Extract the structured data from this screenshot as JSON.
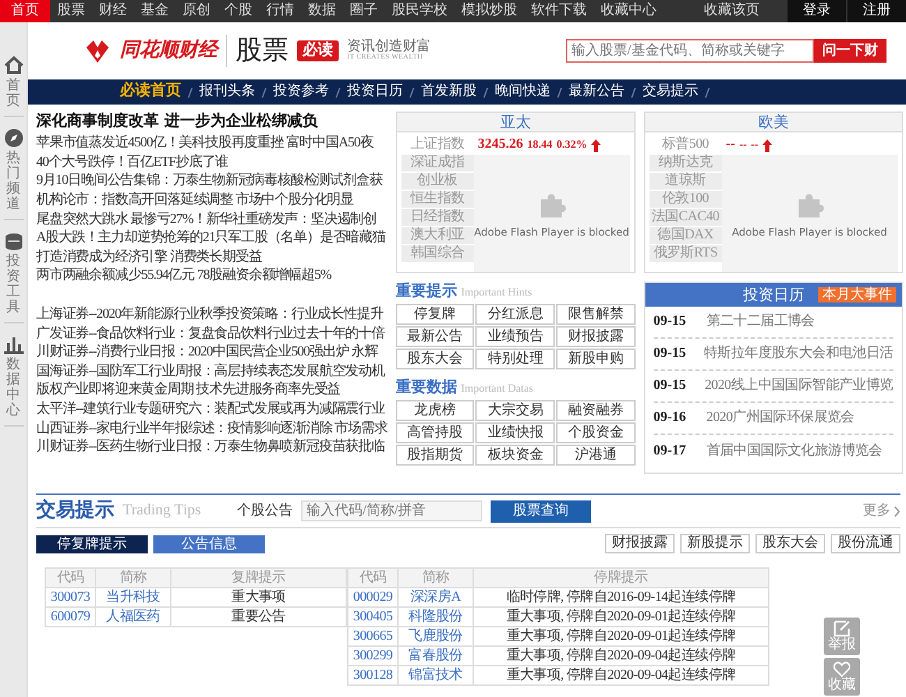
{
  "top_bar": {
    "items": [
      {
        "label": "首页",
        "selected": true
      },
      {
        "label": "股票",
        "selected": false
      },
      {
        "label": "财经",
        "selected": false
      },
      {
        "label": "基金",
        "selected": false
      },
      {
        "label": "原创",
        "selected": false
      },
      {
        "label": "个股",
        "selected": false
      },
      {
        "label": "行情",
        "selected": false
      },
      {
        "label": "数据",
        "selected": false
      },
      {
        "label": "圈子",
        "selected": false
      },
      {
        "label": "股民学校",
        "selected": false
      },
      {
        "label": "模拟炒股",
        "selected": false
      },
      {
        "label": "软件下载",
        "selected": false
      },
      {
        "label": "收藏中心",
        "selected": false
      }
    ],
    "bookmark": "收藏该页",
    "auth": [
      "登录",
      "注册"
    ]
  },
  "sidebar": [
    {
      "kind": "home",
      "label": "首页"
    },
    {
      "kind": "compass",
      "label": "热门频道"
    },
    {
      "kind": "coins",
      "label": "投资工具"
    },
    {
      "kind": "chart",
      "label": "数据中心"
    }
  ],
  "header": {
    "brand": "同花顺财经",
    "section": "股票",
    "badge": "必读",
    "slogan": "资讯创造财富",
    "slogan_en": "IT CREATES WEALTH",
    "search": {
      "placeholder": "输入股票/基金代码、简称或关键字",
      "button": "问一下财"
    }
  },
  "nav": [
    {
      "label": "必读首页",
      "selected": true
    },
    {
      "label": "报刊头条",
      "selected": false
    },
    {
      "label": "投资参考",
      "selected": false
    },
    {
      "label": "投资日历",
      "selected": false
    },
    {
      "label": "首发新股",
      "selected": false
    },
    {
      "label": "晚间快递",
      "selected": false
    },
    {
      "label": "最新公告",
      "selected": false
    },
    {
      "label": "交易提示",
      "selected": false
    }
  ],
  "headline": "深化商事制度改革 进一步为企业松绑减负",
  "news_groups": [
    [
      "苹果市值蒸发近4500亿！美科技股再度重挫 富时中国A50夜",
      "40个大号跌停！百亿ETF抄底了谁",
      "9月10日晚间公告集锦：万泰生物新冠病毒核酸检测试剂盒获",
      "机构论市：指数高开回落延续调整 市场中个股分化明显",
      "尾盘突然大跳水 最惨亏27%！新华社重磅发声：坚决遏制创",
      "A股大跌！主力却逆势抢筹的21只军工股（名单）是否暗藏猫",
      "打造消费成为经济引擎 消费类长期受益",
      "两市两融余额减少55.94亿元 78股融资余额增幅超5%"
    ],
    [
      "上海证券--2020年新能源行业秋季投资策略：行业成长性提升",
      "广发证券--食品饮料行业：复盘食品饮料行业过去十年的十倍",
      "川财证券--消费行业日报：2020中国民营企业500强出炉 永辉",
      "国海证券--国防军工行业周报：高层持续表态发展航空发动机",
      "版权产业即将迎来黄金周期 技术先进服务商率先受益",
      "太平洋--建筑行业专题研究六：装配式发展或再为减隔震行业",
      "山西证券--家电行业半年报综述：疫情影响逐渐消除 市场需求",
      "川财证券--医药生物行业日报：万泰生物鼻喷新冠疫苗获批临"
    ]
  ],
  "markets": [
    {
      "title": "亚太",
      "rows": [
        {
          "name": "上证指数",
          "selected": true,
          "value": "3245.26",
          "change": "18.44",
          "percent": "0.32%",
          "rising": true
        },
        {
          "name": "深证成指",
          "selected": false
        },
        {
          "name": "创业板",
          "selected": false
        },
        {
          "name": "恒生指数",
          "selected": false
        },
        {
          "name": "日经指数",
          "selected": false
        },
        {
          "name": "澳大利亚",
          "selected": false
        },
        {
          "name": "韩国综合",
          "selected": false
        }
      ],
      "plugin_message": "Adobe Flash Player is blocked"
    },
    {
      "title": "欧美",
      "rows": [
        {
          "name": "标普500",
          "selected": true,
          "value": "--",
          "change": "--",
          "percent": "--",
          "rising": true
        },
        {
          "name": "纳斯达克",
          "selected": false
        },
        {
          "name": "道琼斯",
          "selected": false
        },
        {
          "name": "伦敦100",
          "selected": false
        },
        {
          "name": "法国CAC40",
          "selected": false
        },
        {
          "name": "德国DAX",
          "selected": false
        },
        {
          "name": "俄罗斯RTS",
          "selected": false
        }
      ],
      "plugin_message": "Adobe Flash Player is blocked"
    }
  ],
  "hints": {
    "title": "重要提示",
    "subtitle": "Important Hints",
    "items": [
      "停复牌",
      "分红派息",
      "限售解禁",
      "最新公告",
      "业绩预告",
      "财报披露",
      "股东大会",
      "特别处理",
      "新股申购"
    ]
  },
  "datas": {
    "title": "重要数据",
    "subtitle": "Important Datas",
    "items": [
      "龙虎榜",
      "大宗交易",
      "融资融券",
      "高管持股",
      "业绩快报",
      "个股资金",
      "股指期货",
      "板块资金",
      "沪港通"
    ]
  },
  "calendar": {
    "title": "投资日历",
    "badge": "本月大事件",
    "events": [
      {
        "date": "09-15",
        "text": "第二十二届工博会"
      },
      {
        "date": "09-15",
        "text": "特斯拉年度股东大会和电池日活"
      },
      {
        "date": "09-15",
        "text": "2020线上中国国际智能产业博览"
      },
      {
        "date": "09-16",
        "text": "2020广州国际环保展览会"
      },
      {
        "date": "09-17",
        "text": "首届中国国际文化旅游博览会"
      }
    ]
  },
  "trading": {
    "title": "交易提示",
    "subtitle": "Trading Tips",
    "search_label": "个股公告",
    "placeholder": "输入代码/简称/拼音",
    "button": "股票查询",
    "more": "更多",
    "tabs": [
      {
        "label": "停复牌提示",
        "selected": true
      },
      {
        "label": "公告信息",
        "selected": false
      }
    ],
    "filters": [
      "财报披露",
      "新股提示",
      "股东大会",
      "股份流通"
    ],
    "tables": [
      {
        "columns": [
          "代码",
          "简称",
          "复牌提示"
        ],
        "rows": [
          [
            "300073",
            "当升科技",
            "重大事项"
          ],
          [
            "600079",
            "人福医药",
            "重要公告"
          ]
        ]
      },
      {
        "columns": [
          "代码",
          "简称",
          "停牌提示"
        ],
        "rows": [
          [
            "000029",
            "深深房A",
            "临时停牌, 停牌自2016-09-14起连续停牌"
          ],
          [
            "300405",
            "科隆股份",
            "重大事项, 停牌自2020-09-01起连续停牌"
          ],
          [
            "300665",
            "飞鹿股份",
            "重大事项, 停牌自2020-09-01起连续停牌"
          ],
          [
            "300299",
            "富春股份",
            "重大事项, 停牌自2020-09-04起连续停牌"
          ],
          [
            "300128",
            "锦富技术",
            "重大事项, 停牌自2020-09-04起连续停牌"
          ]
        ]
      }
    ]
  },
  "floating": [
    {
      "kind": "report",
      "label": "举报"
    },
    {
      "kind": "favorite",
      "label": "收藏"
    }
  ]
}
